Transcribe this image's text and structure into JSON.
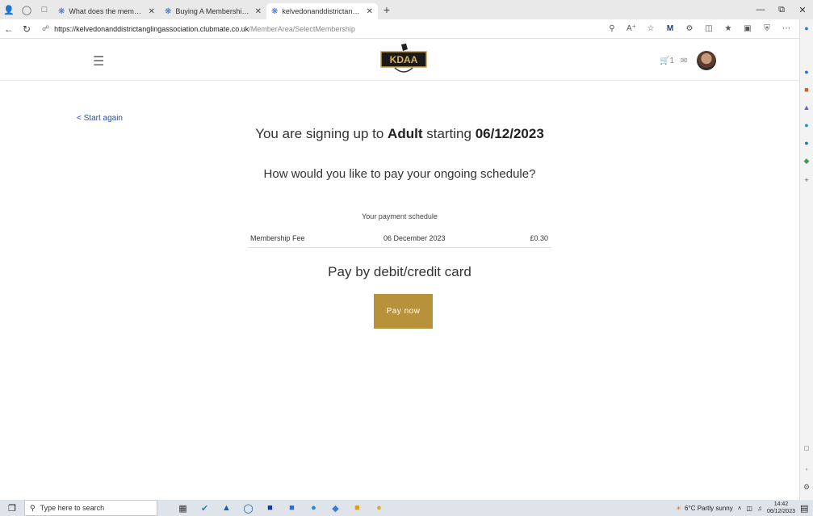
{
  "browser": {
    "tabs": [
      {
        "title": "What does the member online jo",
        "active": false
      },
      {
        "title": "Buying A Membership Guide | Cl",
        "active": false
      },
      {
        "title": "kelvedonanddistrictanglingassoc",
        "active": true
      }
    ],
    "url_domain": "https://kelvedonanddistrictanglingassociation.clubmate.co.uk",
    "url_path": "/MemberArea/SelectMembership",
    "new_tab_symbol": "+"
  },
  "header": {
    "logo_text": "KDAA",
    "basket_count": "1"
  },
  "main": {
    "start_again": "< Start again",
    "signing_prefix": "You are signing up to",
    "membership": "Adult",
    "signing_middle": "starting",
    "start_date": "06/12/2023",
    "question": "How would you like to pay your ongoing schedule?",
    "schedule_title": "Your payment schedule",
    "schedule": [
      {
        "item": "Membership Fee",
        "date": "06 December 2023",
        "amount": "£0.30"
      }
    ],
    "pay_title": "Pay by debit/credit card",
    "pay_button": "Pay now"
  },
  "taskbar": {
    "search_placeholder": "Type here to search",
    "weather": "6°C  Partly sunny",
    "time": "14:42",
    "date": "06/12/2023"
  },
  "colors": {
    "accent": "#b8923a",
    "link": "#2a4fa8"
  }
}
